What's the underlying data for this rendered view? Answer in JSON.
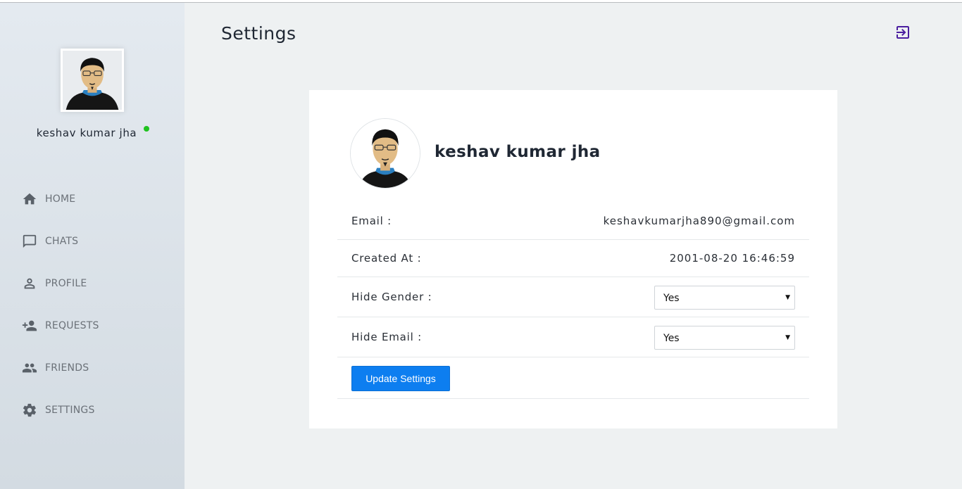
{
  "sidebar": {
    "user_name": "keshav kumar jha",
    "online_color": "#1fc21f",
    "items": [
      {
        "label": "HOME",
        "icon": "home-icon"
      },
      {
        "label": "CHATS",
        "icon": "chat-bubble-icon"
      },
      {
        "label": "PROFILE",
        "icon": "person-icon"
      },
      {
        "label": "REQUESTS",
        "icon": "add-friend-icon"
      },
      {
        "label": "FRIENDS",
        "icon": "people-icon"
      },
      {
        "label": "SETTINGS",
        "icon": "gear-icon"
      }
    ]
  },
  "header": {
    "title": "Settings",
    "logout_icon": "logout-icon",
    "accent_color": "#4b1fa0"
  },
  "card": {
    "user_name": "keshav kumar jha",
    "email_label": "Email :",
    "email_value": "keshavkumarjha890@gmail.com",
    "created_label": "Created At :",
    "created_value": "2001-08-20 16:46:59",
    "hide_gender_label": "Hide Gender :",
    "hide_gender_value": "Yes",
    "hide_email_label": "Hide Email :",
    "hide_email_value": "Yes",
    "update_button": "Update Settings",
    "button_color": "#0d7ef0"
  }
}
